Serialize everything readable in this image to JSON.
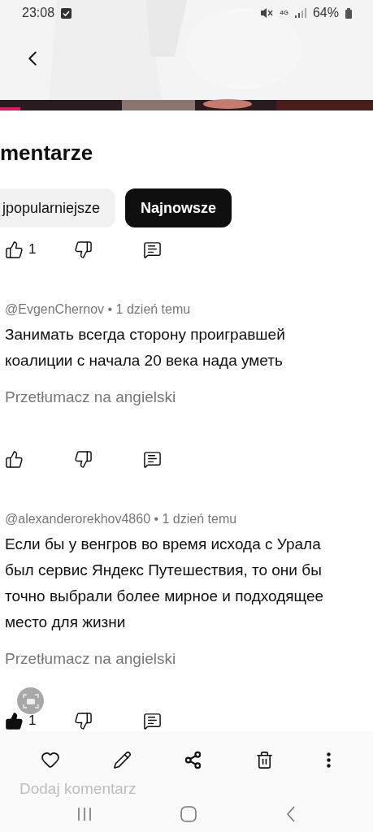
{
  "status_bar": {
    "time": "23:08",
    "network": "4G",
    "battery": "64%"
  },
  "sheet": {
    "title": "mentarze",
    "chips": [
      {
        "label": "jpopularniejsze",
        "selected": false
      },
      {
        "label": "Najnowsze",
        "selected": true
      }
    ]
  },
  "comments": [
    {
      "kind": "actions",
      "likes": "1",
      "liked": false
    },
    {
      "kind": "comment",
      "meta": "@EvgenChernov • 1 dzień temu",
      "text": "Занимать всегда сторону проигравшей коалиции с начала 20 века нада уметь",
      "translate": "Przetłumacz na angielski",
      "liked": false
    },
    {
      "kind": "comment",
      "meta": "@alexanderorekhov4860 • 1 dzień temu",
      "text": "Если бы у венгров во время исхода с Урала был сервис Яндекс Путешествия, то они бы точно выбрали более мирное и подходящее место для жизни",
      "translate": "Przetłumacz na angielski",
      "likes": "1",
      "liked": true
    }
  ],
  "comment_field": {
    "placeholder": "Dodaj komentarz"
  }
}
